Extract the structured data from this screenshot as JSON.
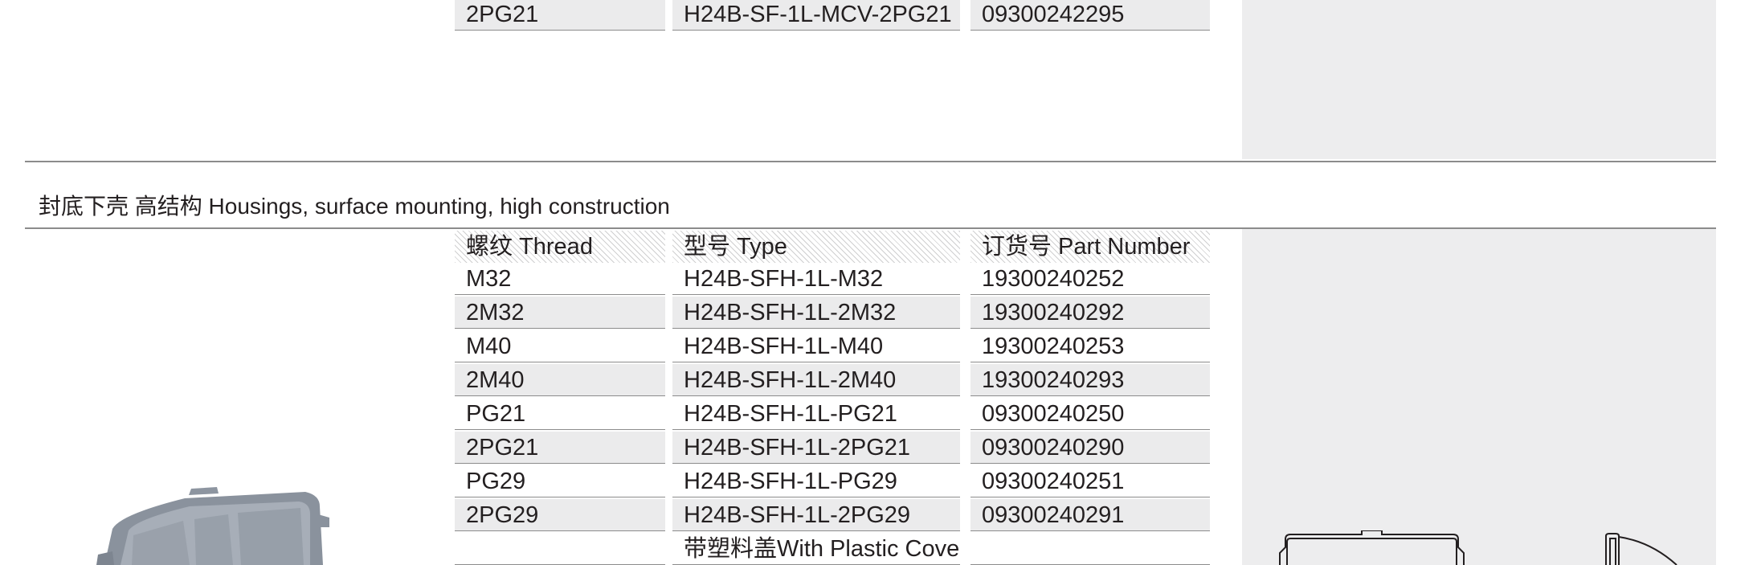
{
  "top_row": {
    "thread": "2PG21",
    "type": "H24B-SF-1L-MCV-2PG21",
    "part_number": "09300242295"
  },
  "section": {
    "title": "封底下壳 高结构 Housings, surface mounting, high construction",
    "headers": {
      "thread": "螺纹 Thread",
      "type": "型号 Type",
      "part_number": "订货号 Part Number"
    },
    "rows": [
      {
        "thread": "M32",
        "type": "H24B-SFH-1L-M32",
        "part_number": "19300240252"
      },
      {
        "thread": "2M32",
        "type": "H24B-SFH-1L-2M32",
        "part_number": "19300240292"
      },
      {
        "thread": "M40",
        "type": "H24B-SFH-1L-M40",
        "part_number": "19300240253"
      },
      {
        "thread": "2M40",
        "type": "H24B-SFH-1L-2M40",
        "part_number": "19300240293"
      },
      {
        "thread": "PG21",
        "type": "H24B-SFH-1L-PG21",
        "part_number": "09300240250"
      },
      {
        "thread": "2PG21",
        "type": "H24B-SFH-1L-2PG21",
        "part_number": "09300240290"
      },
      {
        "thread": "PG29",
        "type": "H24B-SFH-1L-PG29",
        "part_number": "09300240251"
      },
      {
        "thread": "2PG29",
        "type": "H24B-SFH-1L-2PG29",
        "part_number": "09300240291"
      }
    ],
    "footer_note": "带塑料盖With Plastic Cover"
  },
  "colors": {
    "panel": "#ededee",
    "row_shade": "#ebebec",
    "rule": "#8c8c8c",
    "text": "#231f20"
  }
}
